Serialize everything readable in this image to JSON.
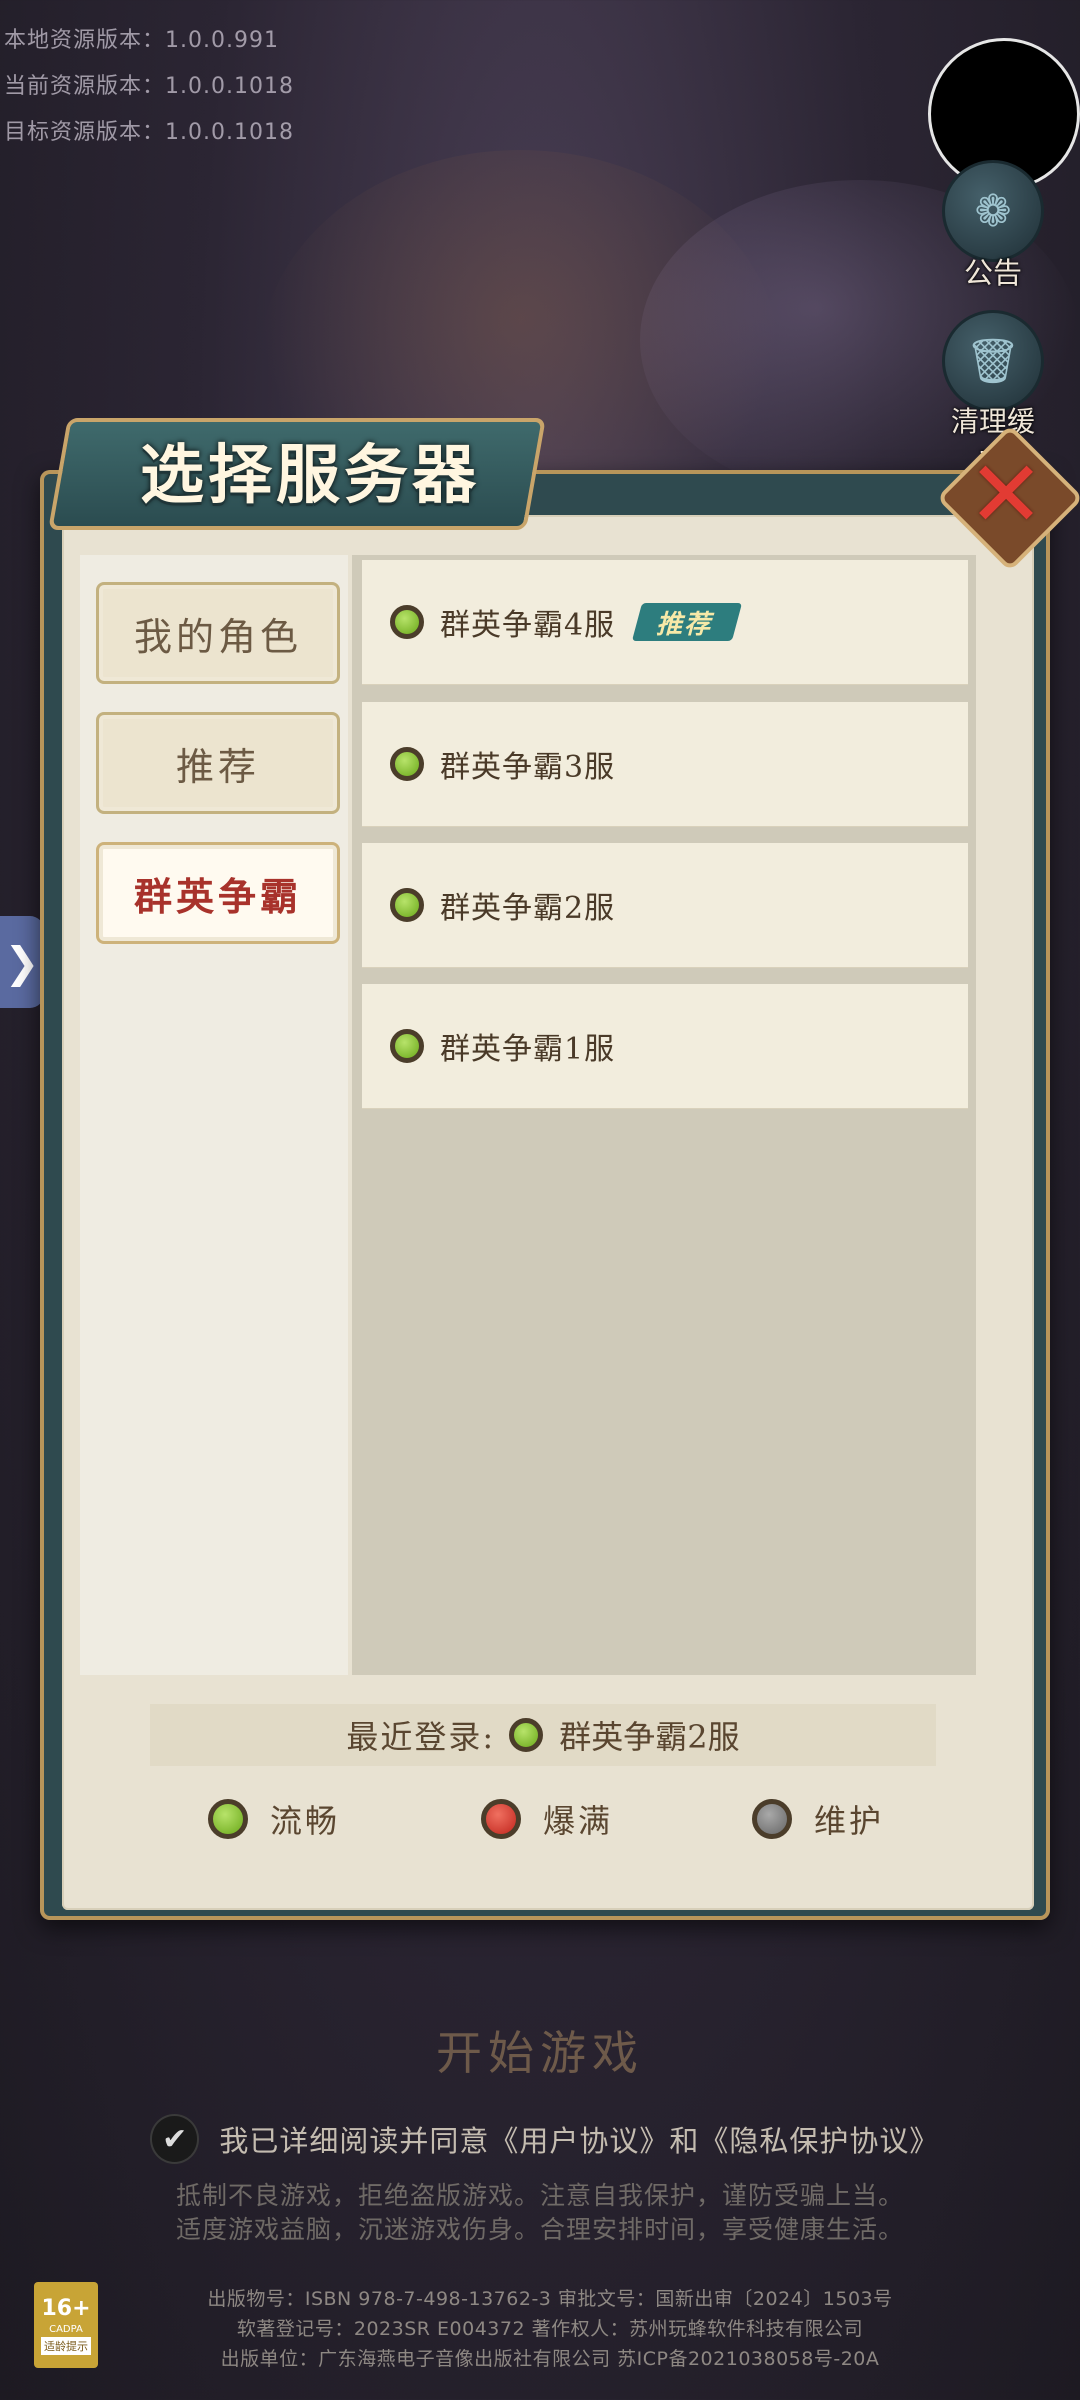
{
  "version_info": {
    "local": "本地资源版本：1.0.0.991",
    "current": "当前资源版本：1.0.0.1018",
    "target": "目标资源版本：1.0.0.1018"
  },
  "side_buttons": {
    "announcement": "公告",
    "clear_cache": "清理缓存"
  },
  "edge_tab_glyph": "❯",
  "dialog": {
    "title": "选择服务器",
    "close_glyph": "✕",
    "tabs": [
      {
        "label": "我的角色",
        "active": false
      },
      {
        "label": "推荐",
        "active": false
      },
      {
        "label": "群英争霸",
        "active": true
      }
    ],
    "servers": [
      {
        "name": "群英争霸4服",
        "status": "green",
        "badge": "推荐"
      },
      {
        "name": "群英争霸3服",
        "status": "green"
      },
      {
        "name": "群英争霸2服",
        "status": "green"
      },
      {
        "name": "群英争霸1服",
        "status": "green"
      }
    ],
    "recent_label": "最近登录:",
    "recent_server": "群英争霸2服",
    "legend": [
      {
        "label": "流畅",
        "color": "green"
      },
      {
        "label": "爆满",
        "color": "red"
      },
      {
        "label": "维护",
        "color": "gray"
      }
    ]
  },
  "start_button": "开始游戏",
  "agreement": "我已详细阅读并同意《用户协议》和《隐私保护协议》",
  "check_glyph": "✔",
  "notice_lines": [
    "抵制不良游戏，拒绝盗版游戏。注意自我保护，谨防受骗上当。",
    "适度游戏益脑，沉迷游戏伤身。合理安排时间，享受健康生活。"
  ],
  "publication_lines": [
    "出版物号：ISBN 978-7-498-13762-3  审批文号：国新出审〔2024〕1503号",
    "软著登记号：2023SR E004372  著作权人：苏州玩蜂软件科技有限公司",
    "出版单位：广东海燕电子音像出版社有限公司  苏ICP备2021038058号-20A"
  ],
  "age_rating": {
    "age": "16+",
    "org": "CADPA",
    "tag": "适龄提示"
  },
  "colors": {
    "accent_red": "#a8322b",
    "teal": "#2d7d7e",
    "gold": "#c9a56a"
  }
}
